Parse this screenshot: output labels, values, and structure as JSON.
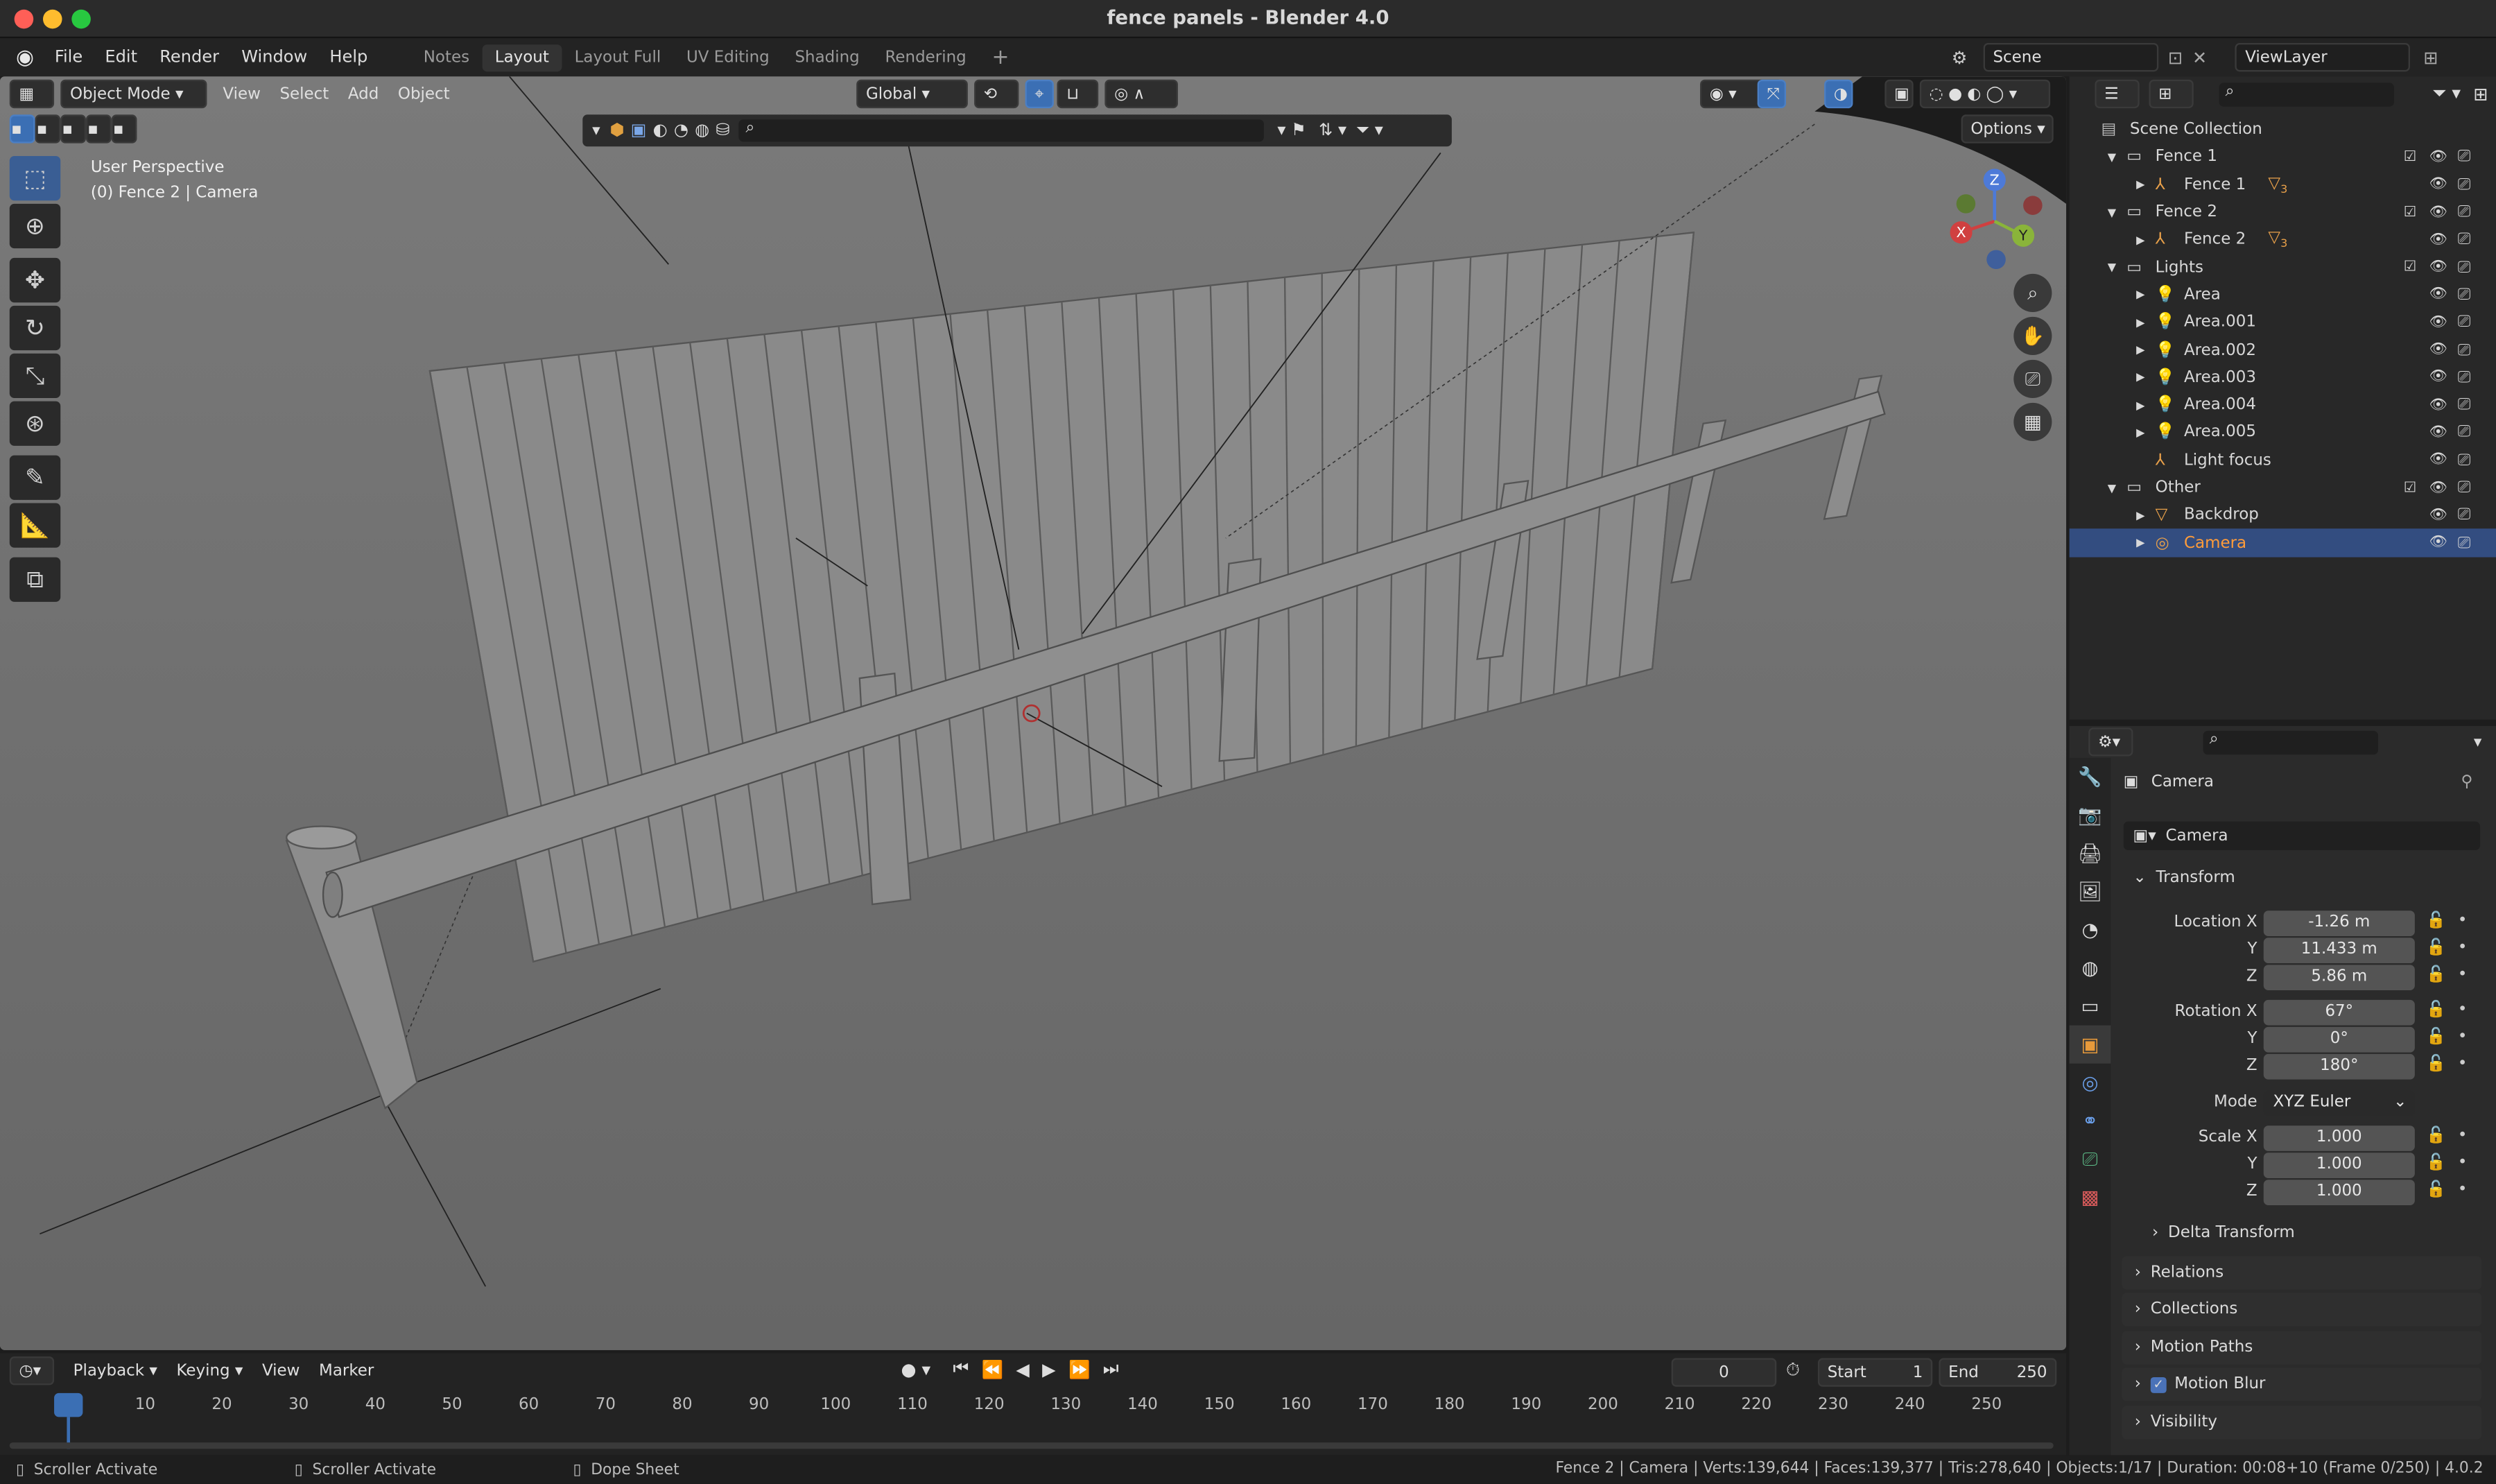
{
  "window": {
    "title": "fence panels - Blender 4.0"
  },
  "menu": [
    "File",
    "Edit",
    "Render",
    "Window",
    "Help"
  ],
  "workspaces": {
    "tabs": [
      "Notes",
      "Layout",
      "Layout Full",
      "UV Editing",
      "Shading",
      "Rendering"
    ],
    "active": "Layout"
  },
  "scene": {
    "label": "Scene",
    "view_layer": "ViewLayer"
  },
  "viewport": {
    "mode": "Object Mode",
    "menus": [
      "View",
      "Select",
      "Add",
      "Object"
    ],
    "orientation": "Global",
    "options_label": "Options",
    "perspective": "User Perspective",
    "context": "(0) Fence 2 | Camera",
    "gizmo": {
      "x": "X",
      "y": "Y",
      "z": "Z"
    }
  },
  "outliner": {
    "root": "Scene Collection",
    "items": [
      {
        "label": "Fence 1",
        "type": "collection"
      },
      {
        "label": "Fence 1",
        "type": "object",
        "badge": "3"
      },
      {
        "label": "Fence 2",
        "type": "collection"
      },
      {
        "label": "Fence 2",
        "type": "object",
        "badge": "3"
      },
      {
        "label": "Lights",
        "type": "collection"
      },
      {
        "label": "Area",
        "type": "light"
      },
      {
        "label": "Area.001",
        "type": "light"
      },
      {
        "label": "Area.002",
        "type": "light"
      },
      {
        "label": "Area.003",
        "type": "light"
      },
      {
        "label": "Area.004",
        "type": "light"
      },
      {
        "label": "Area.005",
        "type": "light"
      },
      {
        "label": "Light focus",
        "type": "empty"
      },
      {
        "label": "Other",
        "type": "collection"
      },
      {
        "label": "Backdrop",
        "type": "mesh"
      },
      {
        "label": "Camera",
        "type": "camera",
        "selected": true
      }
    ]
  },
  "properties": {
    "object_name": "Camera",
    "data_name": "Camera",
    "transform_label": "Transform",
    "location": {
      "label": "Location X",
      "x": "-1.26 m",
      "y": "11.433 m",
      "z": "5.86 m"
    },
    "rotation": {
      "label": "Rotation X",
      "x": "67°",
      "y": "0°",
      "z": "180°"
    },
    "mode": {
      "label": "Mode",
      "value": "XYZ Euler"
    },
    "scale": {
      "label": "Scale X",
      "x": "1.000",
      "y": "1.000",
      "z": "1.000"
    },
    "axis": {
      "y": "Y",
      "z": "Z"
    },
    "delta_label": "Delta Transform",
    "panels": [
      "Relations",
      "Collections",
      "Motion Paths",
      "Motion Blur",
      "Visibility"
    ]
  },
  "timeline": {
    "menus": [
      "Playback",
      "Keying",
      "View",
      "Marker"
    ],
    "current_frame": "0",
    "start_label": "Start",
    "start": "1",
    "end_label": "End",
    "end": "250",
    "ticks": [
      "0",
      "10",
      "20",
      "30",
      "40",
      "50",
      "60",
      "70",
      "80",
      "90",
      "100",
      "110",
      "120",
      "130",
      "140",
      "150",
      "160",
      "170",
      "180",
      "190",
      "200",
      "210",
      "220",
      "230",
      "240",
      "250"
    ]
  },
  "status": {
    "left": [
      "Scroller Activate",
      "Scroller Activate",
      "Dope Sheet"
    ],
    "right": "Fence 2 | Camera | Verts:139,644 | Faces:139,377 | Tris:278,640 | Objects:1/17 | Duration: 00:08+10 (Frame 0/250) | 4.0.2"
  },
  "colors": {
    "accent": "#3b6fb4",
    "selected_text": "#ff9c3a",
    "viewport_bg": "#6f6f6f"
  }
}
